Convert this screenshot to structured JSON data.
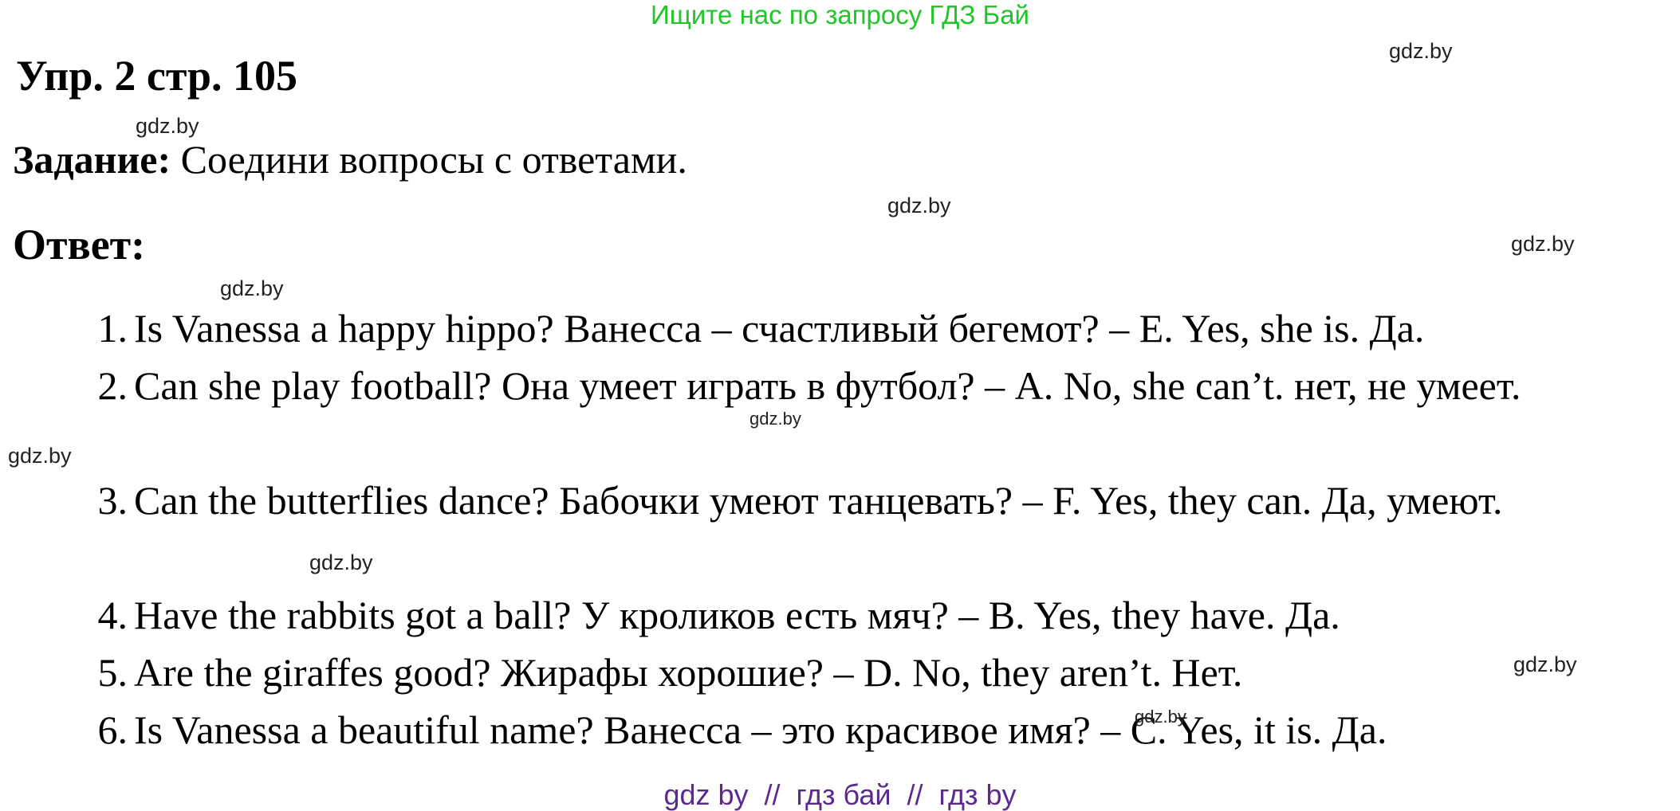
{
  "banner": "Ищите нас по запросу ГДЗ Бай",
  "heading": "Упр. 2 стр. 105",
  "task": {
    "label": "Задание:",
    "text": " Соедини вопросы с ответами."
  },
  "answer_label": "Ответ:",
  "answers": [
    {
      "num": "1.",
      "text": "Is Vanessa a happy hippo? Ванесса – счастливый бегемот? – E. Yes, she is. Да."
    },
    {
      "num": "2.",
      "text": "Can she play football? Она умеет играть в футбол? – A. No, she can’t. нет, не умеет."
    },
    {
      "num": "3.",
      "text": "Can the butterflies dance? Бабочки умеют танцевать? – F. Yes, they can. Да, умеют."
    },
    {
      "num": "4.",
      "text": "Have the rabbits got a ball? У кроликов есть мяч? – B. Yes, they have. Да."
    },
    {
      "num": "5.",
      "text": "Are the giraffes good? Жирафы хорошие? – D. No, they aren’t. Нет."
    },
    {
      "num": "6.",
      "text": "Is Vanessa a beautiful name? Ванесса – это красивое имя? – C. Yes, it is. Да."
    }
  ],
  "watermarks": [
    "gdz.by",
    "gdz.by",
    "gdz.by",
    "gdz.by",
    "gdz.by",
    "gdz.by",
    "gdz.by",
    "gdz.by",
    "gdz.by",
    "gdz.by"
  ],
  "footer": "gdz by  //  гдз бай  //  гдз by",
  "colors": {
    "banner": "#22c62a",
    "footer": "#5a2a8f",
    "text": "#000000"
  }
}
